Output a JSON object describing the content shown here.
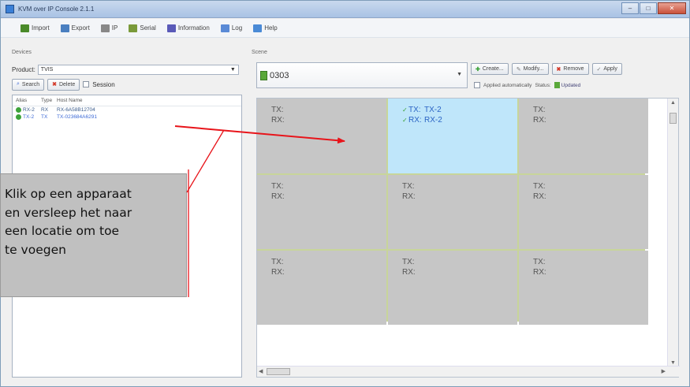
{
  "window": {
    "title": "KVM over IP Console 2.1.1"
  },
  "menubar": {
    "items": [
      {
        "label": "Import",
        "icon": "import-icon",
        "color": "#4a8a2a"
      },
      {
        "label": "Export",
        "icon": "export-icon",
        "color": "#4a7fc0"
      },
      {
        "label": "IP",
        "icon": "ip-icon",
        "color": "#888888"
      },
      {
        "label": "Serial",
        "icon": "serial-icon",
        "color": "#7a9a3a"
      },
      {
        "label": "Information",
        "icon": "info-icon",
        "color": "#5a5ab8"
      },
      {
        "label": "Log",
        "icon": "log-icon",
        "color": "#5a8ad6"
      },
      {
        "label": "Help",
        "icon": "help-icon",
        "color": "#4a8ad6"
      }
    ]
  },
  "devices": {
    "label": "Devices",
    "product_label": "Product:",
    "product_value": "TVIS",
    "search_label": "Search",
    "delete_label": "Delete",
    "session_label": "Session",
    "columns": [
      "Alias",
      "Type",
      "Host Name"
    ],
    "rows": [
      {
        "alias": "RX-2",
        "type": "RX",
        "host": "RX-6A58B12704"
      },
      {
        "alias": "TX-2",
        "type": "TX",
        "host": "TX-023684A6291"
      }
    ]
  },
  "scene": {
    "label": "Scene",
    "selected": "0303",
    "buttons": [
      "Create...",
      "Modify...",
      "Remove",
      "Apply"
    ],
    "apply_auto_label": "Applied automatically",
    "status_label": "Status:",
    "status_value": "Updated",
    "cells": [
      {
        "tx": "TX:",
        "rx": "RX:",
        "tx_value": "",
        "rx_value": "",
        "active": false
      },
      {
        "tx": "TX:",
        "rx": "RX:",
        "tx_value": "TX-2",
        "rx_value": "RX-2",
        "active": true
      },
      {
        "tx": "TX:",
        "rx": "RX:",
        "tx_value": "",
        "rx_value": "",
        "active": false
      },
      {
        "tx": "TX:",
        "rx": "RX:",
        "tx_value": "",
        "rx_value": "",
        "active": false
      },
      {
        "tx": "TX:",
        "rx": "RX:",
        "tx_value": "",
        "rx_value": "",
        "active": false
      },
      {
        "tx": "TX:",
        "rx": "RX:",
        "tx_value": "",
        "rx_value": "",
        "active": false
      },
      {
        "tx": "TX:",
        "rx": "RX:",
        "tx_value": "",
        "rx_value": "",
        "active": false
      },
      {
        "tx": "TX:",
        "rx": "RX:",
        "tx_value": "",
        "rx_value": "",
        "active": false
      },
      {
        "tx": "TX:",
        "rx": "RX:",
        "tx_value": "",
        "rx_value": "",
        "active": false
      }
    ]
  },
  "callout": {
    "lines": [
      "Klik op een apparaat",
      "en versleep het naar",
      "een locatie om toe",
      "te voegen"
    ]
  },
  "colors": {
    "annotation_red": "#e8141a",
    "active_cell": "#bfe6fa",
    "inactive_cell": "#c6c6c6",
    "grid_border": "#c8d59a"
  }
}
